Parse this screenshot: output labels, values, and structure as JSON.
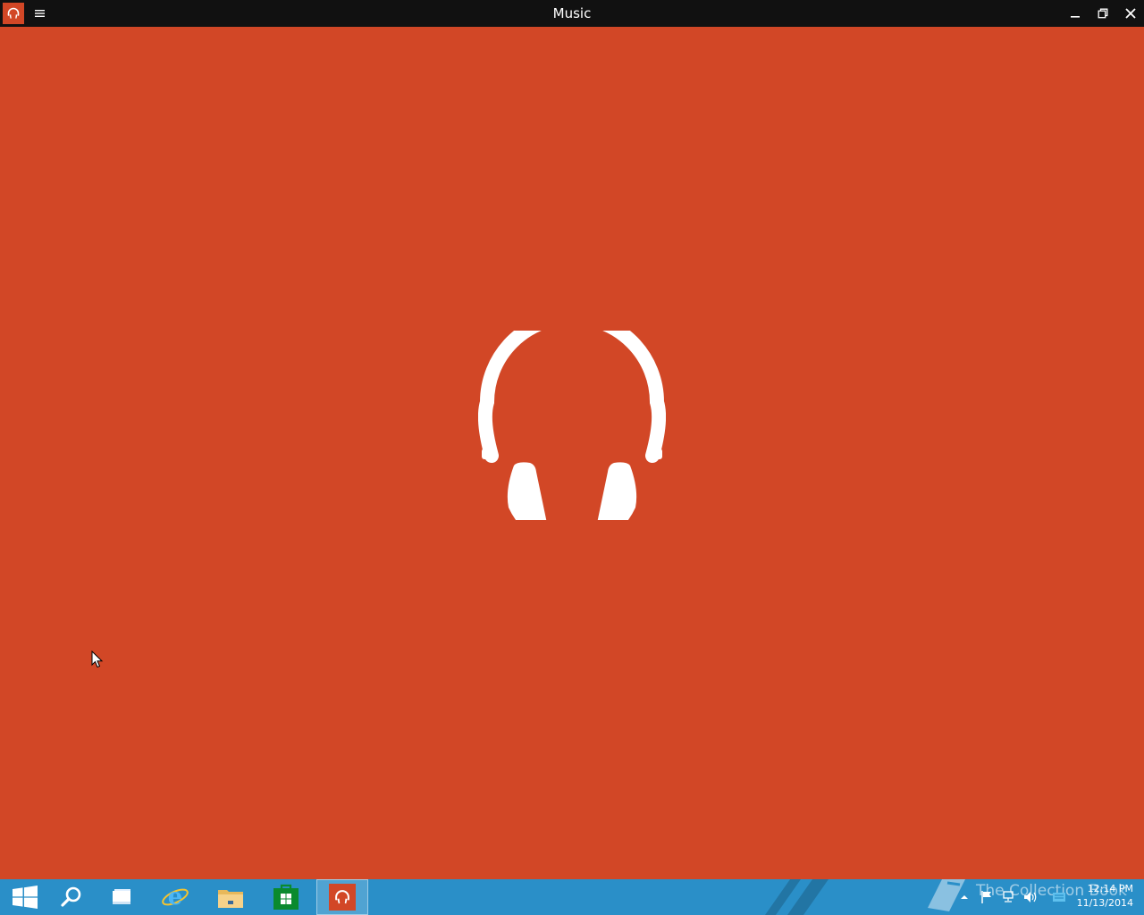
{
  "window": {
    "title": "Music",
    "accent": "#d24726",
    "app_icon": "headphones-icon",
    "menu_icon": "hamburger-icon",
    "controls": [
      "minimize-icon",
      "maximize-icon",
      "close-icon"
    ]
  },
  "main": {
    "splash_icon": "headphones-icon",
    "background": "#d24726"
  },
  "taskbar": {
    "background": "#2a8fc8",
    "items": [
      {
        "name": "start-button",
        "icon": "windows-logo-icon"
      },
      {
        "name": "search-button",
        "icon": "search-icon"
      },
      {
        "name": "task-view-button",
        "icon": "task-view-icon"
      },
      {
        "name": "internet-explorer-button",
        "icon": "internet-explorer-icon"
      },
      {
        "name": "file-explorer-button",
        "icon": "folder-icon"
      },
      {
        "name": "store-button",
        "icon": "store-icon"
      },
      {
        "name": "music-button",
        "icon": "headphones-icon",
        "active": true
      }
    ],
    "watermark": "The Collection Book",
    "tray_icons": [
      "show-hidden-icon",
      "action-center-flag-icon",
      "network-icon",
      "volume-icon",
      "keyboard-icon"
    ],
    "clock": {
      "time": "12:14 PM",
      "date": "11/13/2014"
    }
  }
}
